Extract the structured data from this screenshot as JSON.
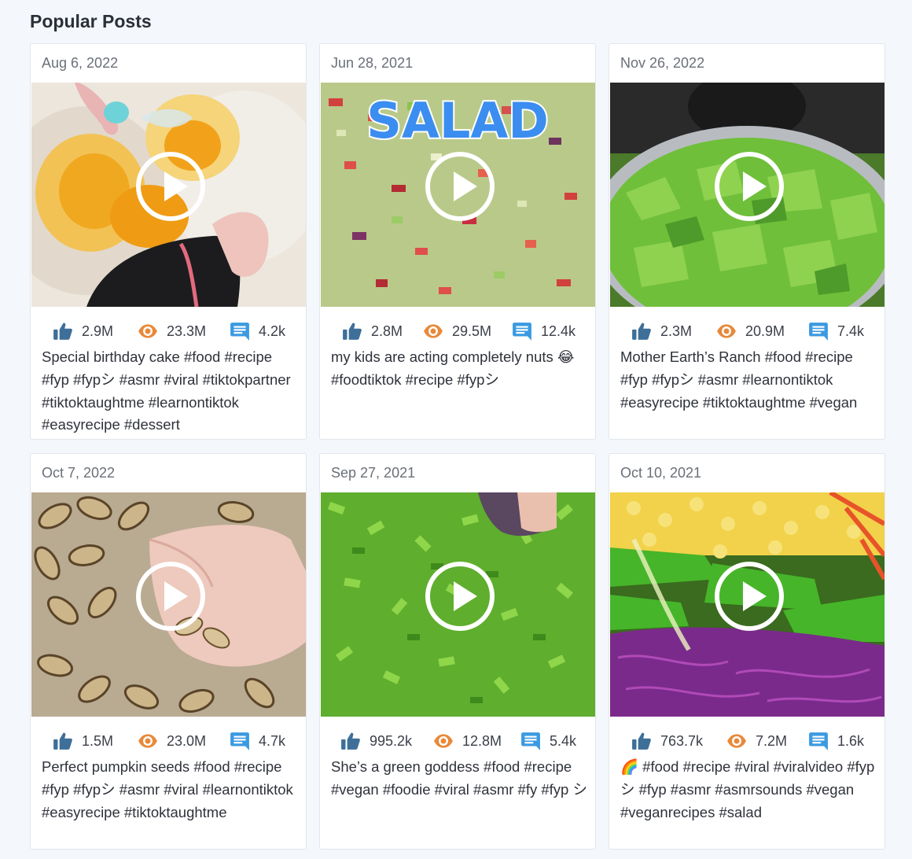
{
  "section": {
    "title": "Popular Posts"
  },
  "icons": {
    "likes": "thumbs-up-icon",
    "views": "eye-icon",
    "comments": "comment-icon",
    "play": "play-icon"
  },
  "colors": {
    "likes": "#3e6f99",
    "views": "#e8893a",
    "comments": "#3b9ae1",
    "accent_text": "#3b8df0"
  },
  "posts": [
    {
      "date": "Aug 6, 2022",
      "likes": "2.9M",
      "views": "23.3M",
      "comments": "4.2k",
      "caption": "Special birthday cake #food #recipe #fyp #fypシ #asmr #viral #tiktokpartner #tiktoktaughtme #learnontiktok #easyrecipe #dessert"
    },
    {
      "date": "Jun 28, 2021",
      "likes": "2.8M",
      "views": "29.5M",
      "comments": "12.4k",
      "thumb_text": "SALAD",
      "caption": "my kids are acting completely nuts 😂 #foodtiktok #recipe #fypシ"
    },
    {
      "date": "Nov 26, 2022",
      "likes": "2.3M",
      "views": "20.9M",
      "comments": "7.4k",
      "caption": "Mother Earth’s Ranch #food #recipe #fyp #fypシ #asmr #learnontiktok #easyrecipe #tiktoktaughtme #vegan"
    },
    {
      "date": "Oct 7, 2022",
      "likes": "1.5M",
      "views": "23.0M",
      "comments": "4.7k",
      "caption": "Perfect pumpkin seeds #food #recipe #fyp #fypシ #asmr #viral #learnontiktok #easyrecipe #tiktoktaughtme"
    },
    {
      "date": "Sep 27, 2021",
      "likes": "995.2k",
      "views": "12.8M",
      "comments": "5.4k",
      "caption": "She’s a green goddess #food #recipe #vegan #foodie #viral #asmr #fy #fyp シ"
    },
    {
      "date": "Oct 10, 2021",
      "likes": "763.7k",
      "views": "7.2M",
      "comments": "1.6k",
      "caption": "🌈 #food #recipe #viral #viralvideo #fypシ #fyp #asmr #asmrsounds #vegan #veganrecipes #salad"
    }
  ]
}
